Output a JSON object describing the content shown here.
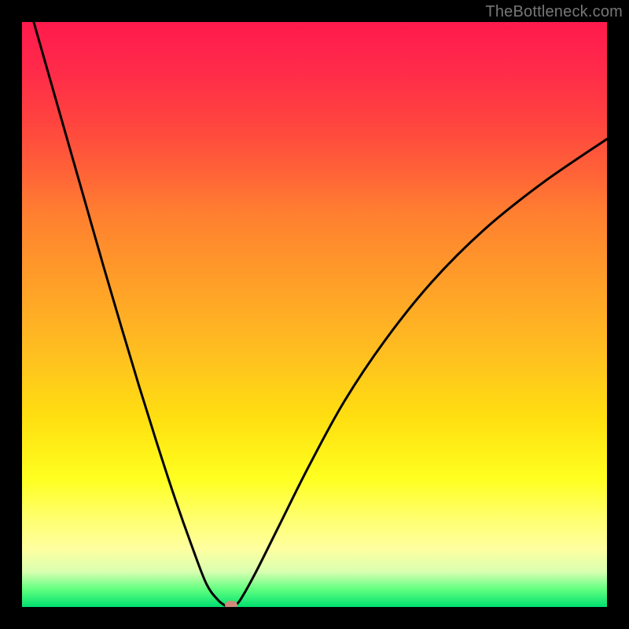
{
  "watermark": "TheBottleneck.com",
  "chart_data": {
    "type": "line",
    "title": "",
    "xlabel": "",
    "ylabel": "",
    "xlim": [
      0,
      1
    ],
    "ylim": [
      0,
      1
    ],
    "series": [
      {
        "name": "bottleneck-curve",
        "x": [
          0.02,
          0.05,
          0.08,
          0.11,
          0.14,
          0.17,
          0.2,
          0.23,
          0.26,
          0.29,
          0.315,
          0.335,
          0.35,
          0.358,
          0.365,
          0.375,
          0.4,
          0.44,
          0.49,
          0.55,
          0.62,
          0.7,
          0.79,
          0.89,
          1.0
        ],
        "y": [
          1.0,
          0.895,
          0.79,
          0.685,
          0.58,
          0.478,
          0.378,
          0.282,
          0.19,
          0.105,
          0.04,
          0.012,
          0.001,
          0.0,
          0.003,
          0.015,
          0.06,
          0.14,
          0.24,
          0.35,
          0.455,
          0.555,
          0.645,
          0.725,
          0.8
        ]
      }
    ],
    "marker": {
      "x": 0.358,
      "y": 0.0
    },
    "background": {
      "type": "vertical-gradient",
      "stops": [
        {
          "pos": 0.0,
          "color": "#ff1a4d"
        },
        {
          "pos": 0.45,
          "color": "#ffa028"
        },
        {
          "pos": 0.78,
          "color": "#ffff20"
        },
        {
          "pos": 0.97,
          "color": "#60ff80"
        },
        {
          "pos": 1.0,
          "color": "#00e070"
        }
      ]
    }
  }
}
